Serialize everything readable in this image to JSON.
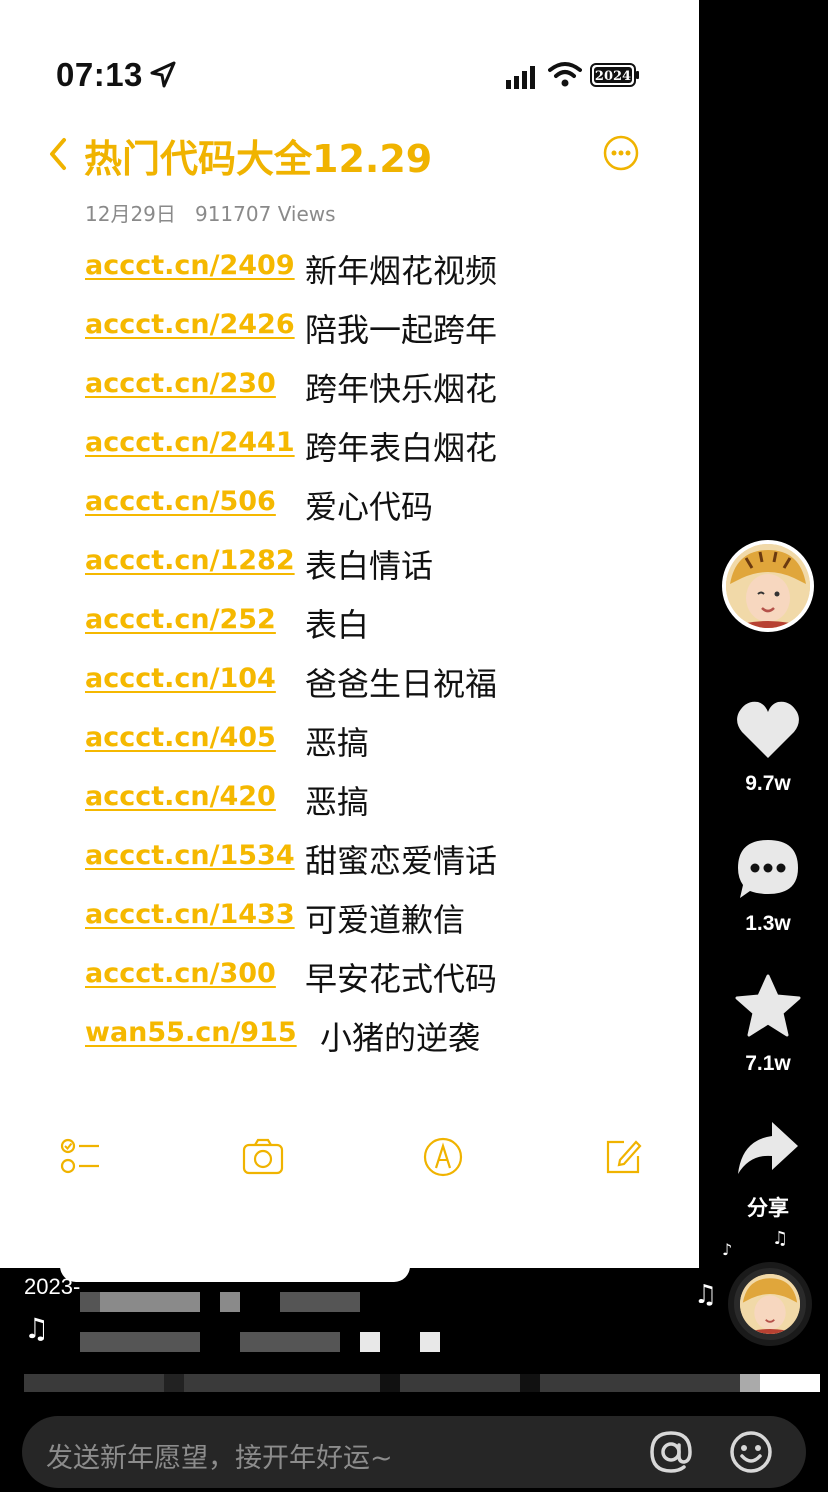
{
  "status_bar": {
    "time": "07:13",
    "battery_label": "2024"
  },
  "note": {
    "title": "热门代码大全12.29",
    "date": "12月29日",
    "views": "911707 Views",
    "items": [
      {
        "link": "accct.cn/2409",
        "desc": "新年烟花视频"
      },
      {
        "link": "accct.cn/2426",
        "desc": "陪我一起跨年"
      },
      {
        "link": "accct.cn/230",
        "desc": "跨年快乐烟花"
      },
      {
        "link": "accct.cn/2441",
        "desc": "跨年表白烟花"
      },
      {
        "link": "accct.cn/506",
        "desc": "爱心代码"
      },
      {
        "link": "accct.cn/1282",
        "desc": "表白情话"
      },
      {
        "link": "accct.cn/252",
        "desc": "表白"
      },
      {
        "link": "accct.cn/104",
        "desc": "爸爸生日祝福"
      },
      {
        "link": "accct.cn/405",
        "desc": "恶搞"
      },
      {
        "link": "accct.cn/420",
        "desc": "恶搞"
      },
      {
        "link": "accct.cn/1534",
        "desc": "甜蜜恋爱情话"
      },
      {
        "link": "accct.cn/1433",
        "desc": "可爱道歉信"
      },
      {
        "link": "accct.cn/300",
        "desc": "早安花式代码"
      },
      {
        "link": "wan55.cn/915",
        "desc": "小猪的逆袭"
      }
    ],
    "accent_color": "#F5B800"
  },
  "sidebar": {
    "likes": "9.7w",
    "comments": "1.3w",
    "favorites": "7.1w",
    "share": "分享"
  },
  "bottom": {
    "date_partial": "2023-",
    "comment_placeholder": "发送新年愿望，接开年好运~"
  }
}
